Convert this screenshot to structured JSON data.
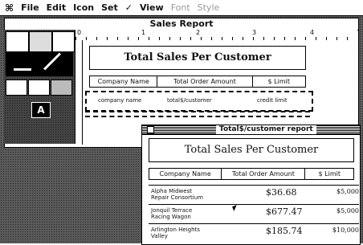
{
  "menubar": {
    "apple": "⌘",
    "items": [
      "File",
      "Edit",
      "Icon",
      "Set",
      "✓",
      "View"
    ],
    "dim_items": [
      "Font",
      "Style"
    ]
  },
  "background_window": {
    "title": "Sales Report",
    "ruler_labels": [
      "0",
      "1",
      "2",
      "3",
      "4"
    ],
    "design": {
      "title": "Total Sales Per Customer",
      "headers": [
        "Company Name",
        "Total Order Amount",
        "$ Limit"
      ],
      "fields": [
        "company name",
        "total$/customer",
        "credit limit"
      ]
    }
  },
  "palette": {
    "letter": "A"
  },
  "front_window": {
    "title": "Total$/customer report",
    "report_title": "Total Sales Per Customer",
    "headers": [
      "Company Name",
      "Total Order Amount",
      "$ Limit"
    ],
    "rows": [
      {
        "name1": "Alpha Midwest",
        "name2": "Repair Consortium",
        "amount": "$36.68",
        "limit": "$5,000"
      },
      {
        "name1": "Jonquil Terrace",
        "name2": "Racing Wagon",
        "amount": "$677.47",
        "limit": "$5,000"
      },
      {
        "name1": "Arlington Heights",
        "name2": "Valley",
        "amount": "$185.74",
        "limit": "$10,000"
      }
    ]
  }
}
